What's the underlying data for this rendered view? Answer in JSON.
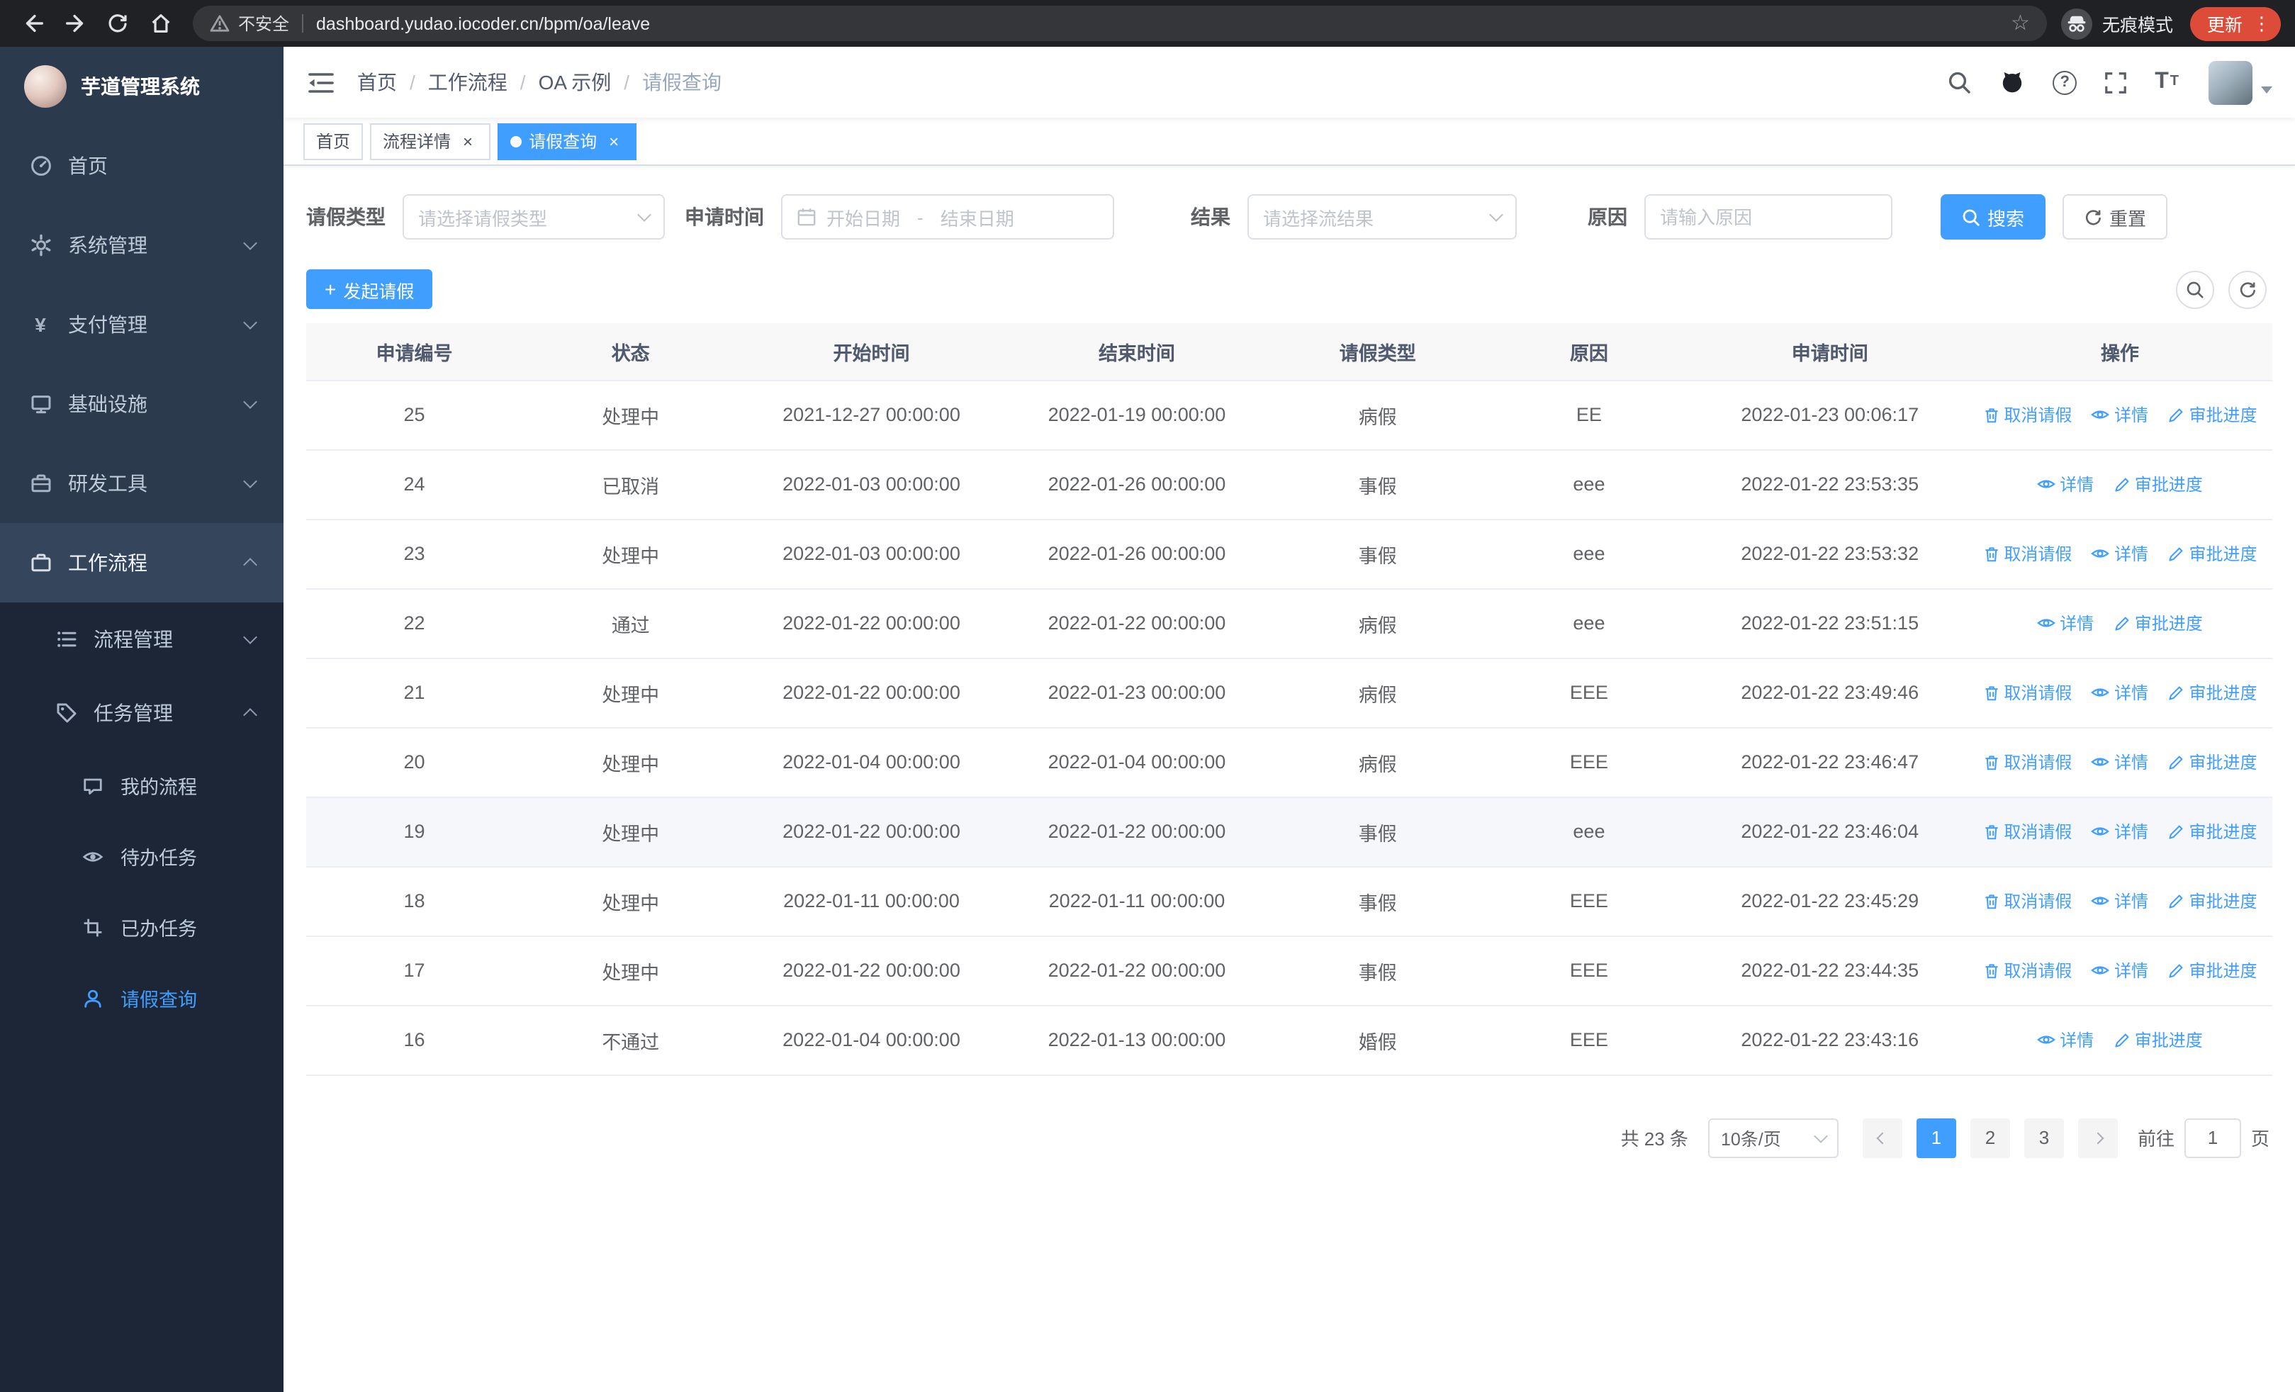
{
  "browser": {
    "security_label": "不安全",
    "url": "dashboard.yudao.iocoder.cn/bpm/oa/leave",
    "incognito_label": "无痕模式",
    "update_label": "更新"
  },
  "sidebar": {
    "logo_title": "芋道管理系统",
    "items": [
      {
        "label": "首页",
        "icon": "dashboard-icon"
      },
      {
        "label": "系统管理",
        "icon": "gear-icon"
      },
      {
        "label": "支付管理",
        "icon": "yen-icon"
      },
      {
        "label": "基础设施",
        "icon": "monitor-icon"
      },
      {
        "label": "研发工具",
        "icon": "toolbox-icon"
      },
      {
        "label": "工作流程",
        "icon": "briefcase-icon"
      }
    ],
    "workflow_children": [
      {
        "label": "流程管理",
        "icon": "list-icon"
      },
      {
        "label": "任务管理",
        "icon": "tag-icon"
      }
    ],
    "task_children": [
      {
        "label": "我的流程",
        "icon": "chat-icon"
      },
      {
        "label": "待办任务",
        "icon": "eye-icon"
      },
      {
        "label": "已办任务",
        "icon": "crop-icon"
      },
      {
        "label": "请假查询",
        "icon": "user-icon"
      }
    ]
  },
  "header": {
    "breadcrumb": [
      "首页",
      "工作流程",
      "OA 示例",
      "请假查询"
    ]
  },
  "tabs": [
    {
      "label": "首页"
    },
    {
      "label": "流程详情"
    },
    {
      "label": "请假查询"
    }
  ],
  "filters": {
    "leave_type_label": "请假类型",
    "leave_type_placeholder": "请选择请假类型",
    "apply_time_label": "申请时间",
    "start_placeholder": "开始日期",
    "separator": "-",
    "end_placeholder": "结束日期",
    "result_label": "结果",
    "result_placeholder": "请选择流结果",
    "reason_label": "原因",
    "reason_placeholder": "请输入原因",
    "search_label": "搜索",
    "reset_label": "重置"
  },
  "toolbar": {
    "create_label": "发起请假"
  },
  "table": {
    "headers": [
      "申请编号",
      "状态",
      "开始时间",
      "结束时间",
      "请假类型",
      "原因",
      "申请时间",
      "操作"
    ],
    "actions": {
      "cancel": "取消请假",
      "detail": "详情",
      "progress": "审批进度"
    },
    "rows": [
      {
        "id": "25",
        "status": "处理中",
        "start": "2021-12-27 00:00:00",
        "end": "2022-01-19 00:00:00",
        "type": "病假",
        "reason": "EE",
        "applied": "2022-01-23 00:06:17",
        "cancelable": true,
        "hover": false
      },
      {
        "id": "24",
        "status": "已取消",
        "start": "2022-01-03 00:00:00",
        "end": "2022-01-26 00:00:00",
        "type": "事假",
        "reason": "eee",
        "applied": "2022-01-22 23:53:35",
        "cancelable": false,
        "hover": false
      },
      {
        "id": "23",
        "status": "处理中",
        "start": "2022-01-03 00:00:00",
        "end": "2022-01-26 00:00:00",
        "type": "事假",
        "reason": "eee",
        "applied": "2022-01-22 23:53:32",
        "cancelable": true,
        "hover": false
      },
      {
        "id": "22",
        "status": "通过",
        "start": "2022-01-22 00:00:00",
        "end": "2022-01-22 00:00:00",
        "type": "病假",
        "reason": "eee",
        "applied": "2022-01-22 23:51:15",
        "cancelable": false,
        "hover": false
      },
      {
        "id": "21",
        "status": "处理中",
        "start": "2022-01-22 00:00:00",
        "end": "2022-01-23 00:00:00",
        "type": "病假",
        "reason": "EEE",
        "applied": "2022-01-22 23:49:46",
        "cancelable": true,
        "hover": false
      },
      {
        "id": "20",
        "status": "处理中",
        "start": "2022-01-04 00:00:00",
        "end": "2022-01-04 00:00:00",
        "type": "病假",
        "reason": "EEE",
        "applied": "2022-01-22 23:46:47",
        "cancelable": true,
        "hover": false
      },
      {
        "id": "19",
        "status": "处理中",
        "start": "2022-01-22 00:00:00",
        "end": "2022-01-22 00:00:00",
        "type": "事假",
        "reason": "eee",
        "applied": "2022-01-22 23:46:04",
        "cancelable": true,
        "hover": true
      },
      {
        "id": "18",
        "status": "处理中",
        "start": "2022-01-11 00:00:00",
        "end": "2022-01-11 00:00:00",
        "type": "事假",
        "reason": "EEE",
        "applied": "2022-01-22 23:45:29",
        "cancelable": true,
        "hover": false
      },
      {
        "id": "17",
        "status": "处理中",
        "start": "2022-01-22 00:00:00",
        "end": "2022-01-22 00:00:00",
        "type": "事假",
        "reason": "EEE",
        "applied": "2022-01-22 23:44:35",
        "cancelable": true,
        "hover": false
      },
      {
        "id": "16",
        "status": "不通过",
        "start": "2022-01-04 00:00:00",
        "end": "2022-01-13 00:00:00",
        "type": "婚假",
        "reason": "EEE",
        "applied": "2022-01-22 23:43:16",
        "cancelable": false,
        "hover": false
      }
    ]
  },
  "pagination": {
    "total": "共 23 条",
    "page_size": "10条/页",
    "pages": [
      "1",
      "2",
      "3"
    ],
    "active_page": "1",
    "goto_label": "前往",
    "goto_value": "1",
    "page_unit": "页"
  },
  "colors": {
    "primary": "#409eff",
    "sidebar_bg": "#2c3a4d",
    "submenu_bg": "#1c2636"
  }
}
